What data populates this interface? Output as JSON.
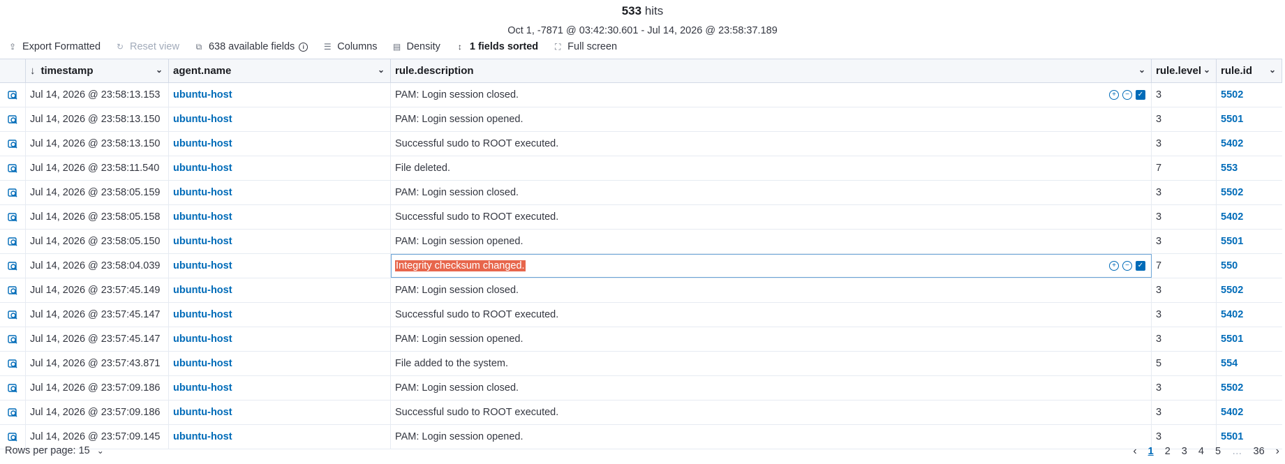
{
  "header": {
    "hits_count": "533",
    "hits_label": "hits",
    "time_range": "Oct 1, -7871 @ 03:42:30.601 - Jul 14, 2026 @ 23:58:37.189"
  },
  "toolbar": {
    "export_label": "Export Formatted",
    "reset_label": "Reset view",
    "fields_label": "638 available fields",
    "columns_label": "Columns",
    "density_label": "Density",
    "sorted_label": "1 fields sorted",
    "fullscreen_label": "Full screen"
  },
  "columns": [
    "timestamp",
    "agent.name",
    "rule.description",
    "rule.level",
    "rule.id"
  ],
  "rows": [
    {
      "timestamp": "Jul 14, 2026 @ 23:58:13.153",
      "agent": "ubuntu-host",
      "description": "PAM: Login session closed.",
      "level": "3",
      "id": "5502"
    },
    {
      "timestamp": "Jul 14, 2026 @ 23:58:13.150",
      "agent": "ubuntu-host",
      "description": "PAM: Login session opened.",
      "level": "3",
      "id": "5501"
    },
    {
      "timestamp": "Jul 14, 2026 @ 23:58:13.150",
      "agent": "ubuntu-host",
      "description": "Successful sudo to ROOT executed.",
      "level": "3",
      "id": "5402"
    },
    {
      "timestamp": "Jul 14, 2026 @ 23:58:11.540",
      "agent": "ubuntu-host",
      "description": "File deleted.",
      "level": "7",
      "id": "553"
    },
    {
      "timestamp": "Jul 14, 2026 @ 23:58:05.159",
      "agent": "ubuntu-host",
      "description": "PAM: Login session closed.",
      "level": "3",
      "id": "5502"
    },
    {
      "timestamp": "Jul 14, 2026 @ 23:58:05.158",
      "agent": "ubuntu-host",
      "description": "Successful sudo to ROOT executed.",
      "level": "3",
      "id": "5402"
    },
    {
      "timestamp": "Jul 14, 2026 @ 23:58:05.150",
      "agent": "ubuntu-host",
      "description": "PAM: Login session opened.",
      "level": "3",
      "id": "5501"
    },
    {
      "timestamp": "Jul 14, 2026 @ 23:58:04.039",
      "agent": "ubuntu-host",
      "description": "Integrity checksum changed.",
      "level": "7",
      "id": "550"
    },
    {
      "timestamp": "Jul 14, 2026 @ 23:57:45.149",
      "agent": "ubuntu-host",
      "description": "PAM: Login session closed.",
      "level": "3",
      "id": "5502"
    },
    {
      "timestamp": "Jul 14, 2026 @ 23:57:45.147",
      "agent": "ubuntu-host",
      "description": "Successful sudo to ROOT executed.",
      "level": "3",
      "id": "5402"
    },
    {
      "timestamp": "Jul 14, 2026 @ 23:57:45.147",
      "agent": "ubuntu-host",
      "description": "PAM: Login session opened.",
      "level": "3",
      "id": "5501"
    },
    {
      "timestamp": "Jul 14, 2026 @ 23:57:43.871",
      "agent": "ubuntu-host",
      "description": "File added to the system.",
      "level": "5",
      "id": "554"
    },
    {
      "timestamp": "Jul 14, 2026 @ 23:57:09.186",
      "agent": "ubuntu-host",
      "description": "PAM: Login session closed.",
      "level": "3",
      "id": "5502"
    },
    {
      "timestamp": "Jul 14, 2026 @ 23:57:09.186",
      "agent": "ubuntu-host",
      "description": "Successful sudo to ROOT executed.",
      "level": "3",
      "id": "5402"
    },
    {
      "timestamp": "Jul 14, 2026 @ 23:57:09.145",
      "agent": "ubuntu-host",
      "description": "PAM: Login session opened.",
      "level": "3",
      "id": "5501"
    }
  ],
  "footer": {
    "rows_per_page": "Rows per page: 15",
    "pages": [
      "1",
      "2",
      "3",
      "4",
      "5"
    ],
    "ellipsis": "…",
    "last_page": "36",
    "active_page": "1"
  },
  "colors": {
    "accent": "#006bb8",
    "highlight": "#e7664c"
  }
}
